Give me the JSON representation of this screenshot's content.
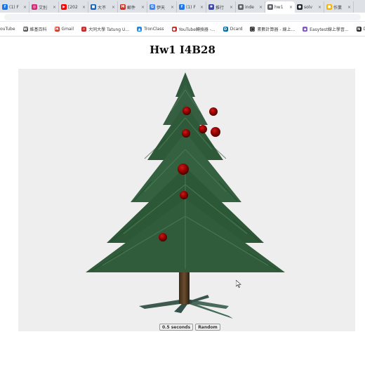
{
  "tabs": [
    {
      "label": "(1) F",
      "icon": "facebook-icon",
      "color": "#1877f2",
      "glyph": "f"
    },
    {
      "label": "艾別",
      "icon": "instagram-icon",
      "color": "#d62976",
      "glyph": "◎"
    },
    {
      "label": "[202",
      "icon": "youtube-icon",
      "color": "#ff0000",
      "glyph": "▶"
    },
    {
      "label": "大不",
      "icon": "site-icon",
      "color": "#1565c0",
      "glyph": "■"
    },
    {
      "label": "郵件",
      "icon": "gmail-icon",
      "color": "#d93025",
      "glyph": "M"
    },
    {
      "label": "伊天",
      "icon": "google-icon",
      "color": "#4285f4",
      "glyph": "G"
    },
    {
      "label": "(1) F",
      "icon": "facebook-icon",
      "color": "#1877f2",
      "glyph": "f"
    },
    {
      "label": "推行",
      "icon": "site-icon",
      "color": "#3949ab",
      "glyph": "✱"
    },
    {
      "label": "inde",
      "icon": "globe-icon",
      "color": "#5f6368",
      "glyph": "◉"
    },
    {
      "label": "hw1",
      "icon": "globe-icon",
      "color": "#5f6368",
      "glyph": "◉",
      "active": true
    },
    {
      "label": "solv",
      "icon": "github-icon",
      "color": "#24292e",
      "glyph": "●"
    },
    {
      "label": "作業",
      "icon": "site-icon",
      "color": "#f4b400",
      "glyph": "■"
    }
  ],
  "bookmarks": [
    {
      "label": "ouTube",
      "icon": "",
      "color": "#ffffff",
      "glyph": ""
    },
    {
      "label": "維基百科",
      "icon": "wikipedia-icon",
      "color": "#555555",
      "glyph": "W"
    },
    {
      "label": "Gmail",
      "icon": "gmail-icon",
      "color": "#d93025",
      "glyph": "M"
    },
    {
      "label": "大同大學 Tatung U...",
      "icon": "tatung-icon",
      "color": "#c62828",
      "glyph": "☼"
    },
    {
      "label": "TronClass",
      "icon": "tronclass-icon",
      "color": "#1e88e5",
      "glyph": "▲"
    },
    {
      "label": "YouTube轉換器 -...",
      "icon": "converter-icon",
      "color": "#c62828",
      "glyph": "●"
    },
    {
      "label": "Dcard",
      "icon": "dcard-icon",
      "color": "#006aa6",
      "glyph": "D"
    },
    {
      "label": "素數計算器 - 線上...",
      "icon": "calculator-icon",
      "color": "#333333",
      "glyph": "◯"
    },
    {
      "label": "Easytest線上學習...",
      "icon": "easytest-icon",
      "color": "#7e57c2",
      "glyph": "◆"
    },
    {
      "label": "DS_SOP",
      "icon": "notion-icon",
      "color": "#222222",
      "glyph": "N"
    }
  ],
  "page": {
    "title": "Hw1 I4B28",
    "speed_button": "0.5 seconds",
    "random_button": "Random"
  }
}
